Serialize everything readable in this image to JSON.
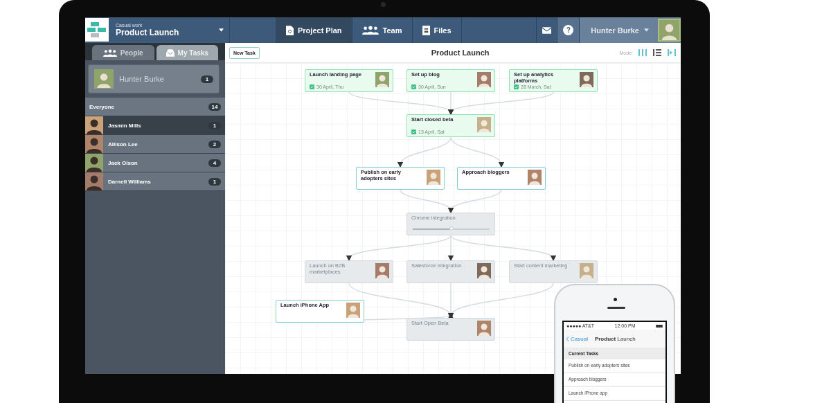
{
  "topbar": {
    "workspace": "Casual work",
    "project": "Product Launch",
    "tabs": [
      {
        "label": "Project Plan",
        "kind": "document",
        "selected": true
      },
      {
        "label": "Team",
        "kind": "people",
        "selected": false
      },
      {
        "label": "Files",
        "kind": "file",
        "selected": false
      }
    ],
    "help": "?",
    "user": "Hunter Burke"
  },
  "sidebar": {
    "tabs": [
      {
        "label": "People",
        "kind": "people",
        "selected": false
      },
      {
        "label": "My Tasks",
        "kind": "tray",
        "selected": true
      }
    ],
    "me": {
      "name": "Hunter Burke",
      "count": "1"
    },
    "group": {
      "name": "Everyone",
      "count": "14"
    },
    "people": [
      {
        "name": "Jasmin Mills",
        "count": "1",
        "selected": true
      },
      {
        "name": "Allison Lee",
        "count": "2",
        "selected": false
      },
      {
        "name": "Jack Olson",
        "count": "4",
        "selected": false
      },
      {
        "name": "Darnell Williams",
        "count": "1",
        "selected": false
      }
    ]
  },
  "board": {
    "new_task": "New Task",
    "title": "Product Launch",
    "mode_label": "Mode:",
    "modes": [
      {
        "kind": "columns",
        "selected": false
      },
      {
        "kind": "list",
        "selected": true
      },
      {
        "kind": "split",
        "selected": false
      }
    ],
    "tasks": [
      {
        "title": "Launch landing page",
        "kind": "done",
        "date": "30 April, Thu"
      },
      {
        "title": "Set up blog",
        "kind": "done",
        "date": "30 April, Sun"
      },
      {
        "title": "Set up analytics platforms",
        "kind": "done",
        "date": "28 March, Sat"
      },
      {
        "title": "Start closed beta",
        "kind": "done",
        "date": "13 April, Sat"
      },
      {
        "title": "Publish on early adopters sites",
        "kind": "active"
      },
      {
        "title": "Approach bloggers",
        "kind": "active"
      },
      {
        "title": "Chrome integration",
        "kind": "pending",
        "level": 0.5
      },
      {
        "title": "Launch on B2B marketplaces",
        "kind": "pending"
      },
      {
        "title": "Salesforce integration",
        "kind": "pending"
      },
      {
        "title": "Start content marketing",
        "kind": "pending"
      },
      {
        "title": "Launch iPhone App",
        "kind": "active"
      },
      {
        "title": "Start Open Beta",
        "kind": "pending"
      }
    ]
  },
  "phone": {
    "carrier": "●●●●● AT&T",
    "time": "12:00 PM",
    "back": "Casual",
    "title": "**Product** Launch",
    "section": "Current Tasks",
    "items": [
      "Publish on early adopters sites",
      "Approach bloggers",
      "Launch iPhone app"
    ]
  }
}
